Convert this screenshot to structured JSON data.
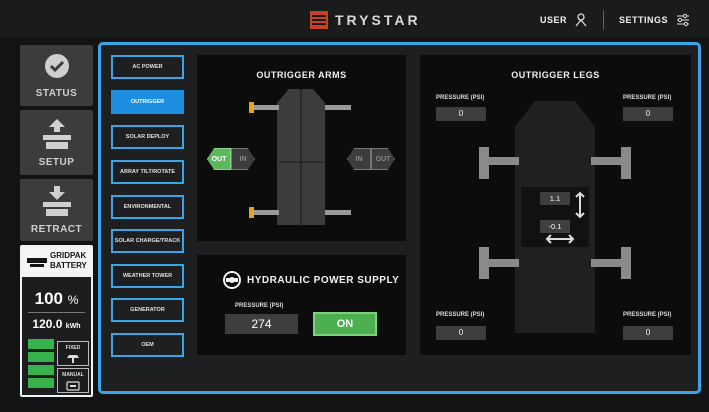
{
  "header": {
    "brand": "TRYSTAR",
    "user_label": "USER",
    "settings_label": "SETTINGS"
  },
  "sidebar": {
    "items": [
      {
        "label": "STATUS",
        "icon": "check-circle-icon"
      },
      {
        "label": "SETUP",
        "icon": "raise-panel-icon"
      },
      {
        "label": "RETRACT",
        "icon": "lower-panel-icon"
      }
    ],
    "battery": {
      "title_line1": "GRIDPAK",
      "title_line2": "BATTERY",
      "percent": "100",
      "percent_unit": "%",
      "energy": "120.0",
      "energy_unit": "kWh",
      "charge_level": 1.0,
      "cells_color": "#37b24d",
      "modes": [
        {
          "label": "FIXED",
          "icon": "fixed-array-icon"
        },
        {
          "label": "MANUAL",
          "icon": "manual-remote-icon"
        }
      ]
    }
  },
  "subnav": {
    "items": [
      "AC POWER",
      "OUTRIGGER",
      "SOLAR DEPLOY",
      "ARRAY TILT/ROTATE",
      "ENVIRONMENTAL",
      "SOLAR CHARGE/TRACK",
      "WEATHER TOWER",
      "GENERATOR",
      "OEM"
    ],
    "active": "OUTRIGGER"
  },
  "arms": {
    "title": "OUTRIGGER ARMS",
    "left_out": "OUT",
    "left_in": "IN",
    "right_in": "IN",
    "right_out": "OUT"
  },
  "hydraulic": {
    "title": "HYDRAULIC POWER SUPPLY",
    "pressure_label": "PRESSURE (PSI)",
    "pressure_value": "274",
    "state": "ON"
  },
  "legs": {
    "title": "OUTRIGGER LEGS",
    "pressure_label": "PRESSURE (PSI)",
    "front_left": "0",
    "front_right": "0",
    "rear_left": "0",
    "rear_right": "0",
    "tilt_y": "1.1",
    "tilt_x": "-0.1"
  },
  "colors": {
    "accent": "#3aa4e6",
    "active_tab": "#1e8fe0",
    "on_green": "#4caf50",
    "brand_red": "#c8421f",
    "arm_yellow": "#e0a42a"
  }
}
